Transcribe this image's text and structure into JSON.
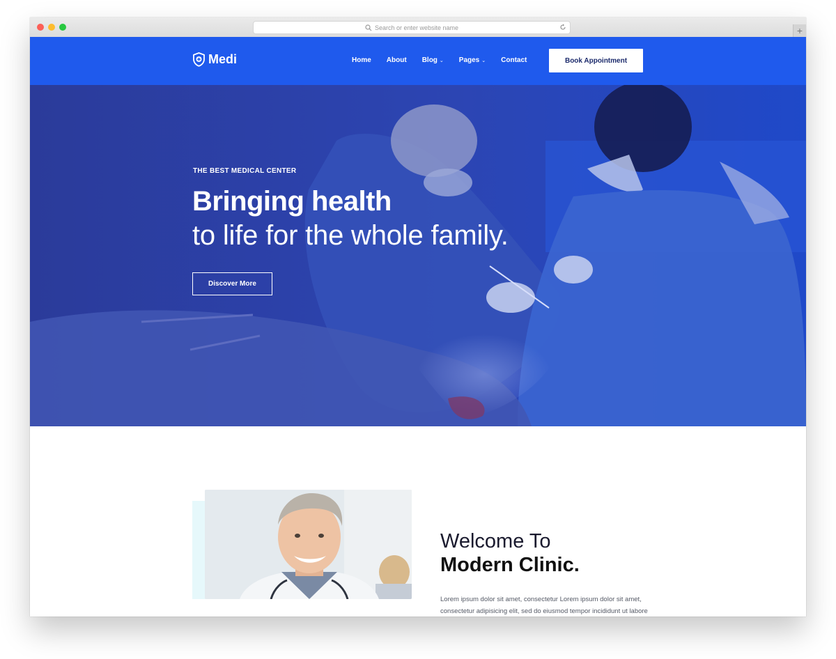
{
  "browser": {
    "url_placeholder": "Search or enter website name",
    "new_tab_symbol": "+"
  },
  "header": {
    "brand": "Medi",
    "nav": [
      {
        "label": "Home"
      },
      {
        "label": "About"
      },
      {
        "label": "Blog",
        "dropdown": true
      },
      {
        "label": "Pages",
        "dropdown": true
      },
      {
        "label": "Contact"
      }
    ],
    "cta_label": "Book Appointment",
    "bg_color": "#1f5aed"
  },
  "hero": {
    "eyebrow": "THE BEST MEDICAL CENTER",
    "title_line1": "Bringing health",
    "title_line2": "to life for the whole family.",
    "button_label": "Discover More"
  },
  "welcome": {
    "line1": "Welcome To",
    "line2": "Modern Clinic.",
    "paragraph_line1": "Lorem ipsum dolor sit amet, consectetur Lorem ipsum dolor sit amet,",
    "paragraph_line2": "consectetur adipisicing elit, sed do eiusmod tempor incididunt ut labore"
  },
  "icons": {
    "logo": "shield-plus-icon",
    "search": "search-icon",
    "reload": "reload-icon",
    "dropdown": "chevron-down-icon"
  }
}
